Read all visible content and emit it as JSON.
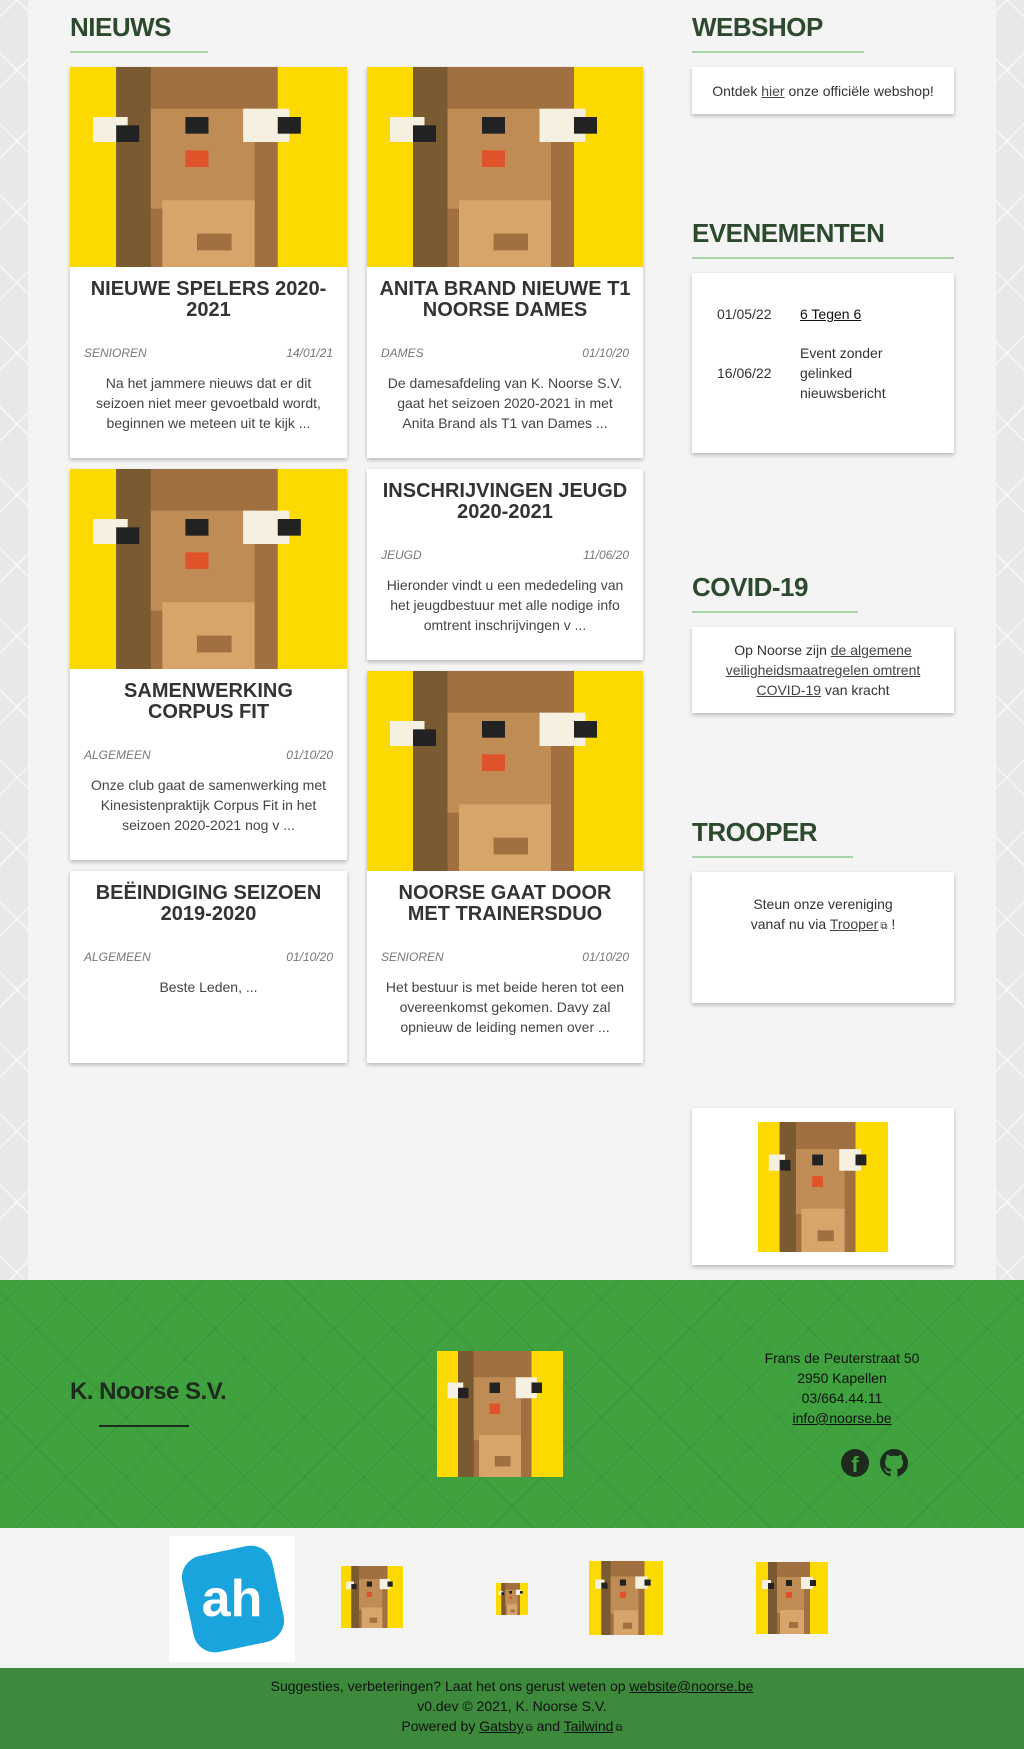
{
  "colors": {
    "accent_green": "#3fa23f",
    "dark_green": "#3d8a3d",
    "title_underline": "#a9d3a9",
    "bear_yellow": "#fcda00"
  },
  "news": {
    "title": "NIEUWS",
    "items": [
      {
        "title": "NIEUWE SPELERS 2020-2021",
        "category": "SENIOREN",
        "date": "14/01/21",
        "excerpt": "Na het jammere nieuws dat er dit seizoen niet meer gevoetbald wordt, beginnen we meteen uit te kijk ..."
      },
      {
        "title": "ANITA BRAND NIEUWE T1 NOORSE DAMES",
        "category": "DAMES",
        "date": "01/10/20",
        "excerpt": "De damesafdeling van K. Noorse S.V. gaat het seizoen 2020-2021 in met Anita Brand als T1 van Dames ..."
      },
      {
        "title": "INSCHRIJVINGEN JEUGD 2020-2021",
        "category": "JEUGD",
        "date": "11/06/20",
        "excerpt": "Hieronder vindt u een mededeling van het jeugdbestuur met alle nodige info omtrent inschrijvingen v ..."
      },
      {
        "title": "SAMENWERKING CORPUS FIT",
        "category": "ALGEMEEN",
        "date": "01/10/20",
        "excerpt": "Onze club gaat de samenwerking met Kinesistenpraktijk Corpus Fit in het seizoen 2020-2021 nog v ..."
      },
      {
        "title": "NOORSE GAAT DOOR MET TRAINERSDUO",
        "category": "SENIOREN",
        "date": "01/10/20",
        "excerpt": "Het bestuur is met beide heren tot een overeenkomst gekomen. Davy zal opnieuw de leiding nemen over ..."
      },
      {
        "title": "BEËINDIGING SEIZOEN 2019-2020",
        "category": "ALGEMEEN",
        "date": "01/10/20",
        "excerpt": "Beste Leden,   ..."
      }
    ]
  },
  "webshop": {
    "title": "WEBSHOP",
    "text_before": "Ontdek ",
    "link": "hier",
    "text_after": " onze officiële webshop!"
  },
  "events": {
    "title": "EVENEMENTEN",
    "rows": [
      {
        "date": "01/05/22",
        "name": "6 Tegen 6"
      },
      {
        "date": "16/06/22",
        "name": "Event zonder gelinked nieuwsbericht"
      }
    ]
  },
  "covid": {
    "title": "COVID-19",
    "text_before": "Op Noorse zijn ",
    "link": "de algemene veiligheidsmaatregelen omtrent COVID-19",
    "text_after": " van kracht"
  },
  "trooper": {
    "title": "TROOPER",
    "line1": "Steun onze vereniging",
    "line2_before": "vanaf nu via ",
    "link": "Trooper",
    "line2_after": " !"
  },
  "footer": {
    "club_name": "K. Noorse S.V.",
    "address1": "Frans de Peuterstraat 50",
    "address2": "2950 Kapellen",
    "phone": "03/664.44.11",
    "email": "info@noorse.be",
    "social_icons": [
      "facebook-icon",
      "github-icon"
    ]
  },
  "sponsors": {
    "first_logo_text": "ah"
  },
  "bottom": {
    "suggest_before": "Suggesties, verbeteringen? Laat het ons gerust weten op ",
    "suggest_email": "website@noorse.be",
    "copyright": "v0.dev © 2021, K. Noorse S.V.",
    "powered_before": "Powered by ",
    "gatsby": "Gatsby",
    "and": " and ",
    "tailwind": "Tailwind"
  }
}
